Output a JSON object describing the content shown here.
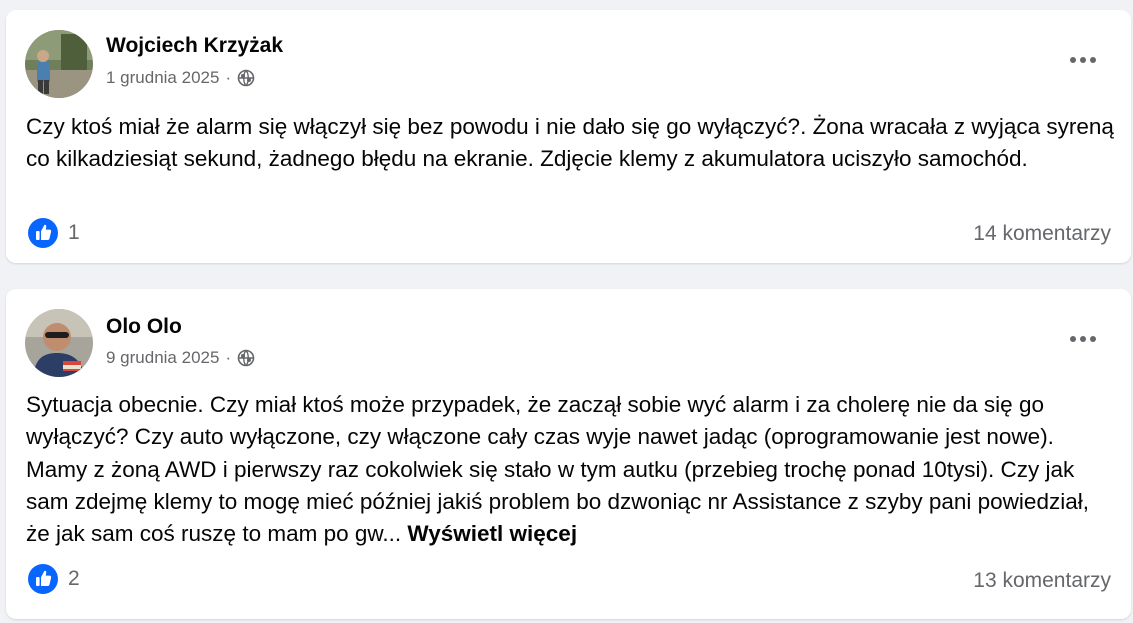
{
  "posts": [
    {
      "author": "Wojciech Krzyżak",
      "date": "1 grudnia 2025",
      "separator": "·",
      "privacy_icon": "globe-icon",
      "body": "Czy ktoś miał że alarm się włączył się bez powodu i nie dało się go wyłączyć?. Żona wracała z wyjąca syreną co kilkadziesiąt sekund, żadnego błędu na ekranie. Zdjęcie klemy z akumulatora uciszyło samochód.",
      "see_more": "",
      "reaction_icon": "like-icon",
      "reaction_count": "1",
      "comments": "14 komentarzy"
    },
    {
      "author": "Olo Olo",
      "date": "9 grudnia 2025",
      "separator": "·",
      "privacy_icon": "globe-icon",
      "body": "Sytuacja obecnie. Czy miał ktoś może przypadek, że zaczął sobie wyć alarm i za cholerę nie da się go wyłączyć? Czy auto wyłączone, czy włączone cały czas wyje nawet jadąc (oprogramowanie jest nowe). Mamy z żoną AWD i pierwszy raz cokolwiek się stało w tym autku (przebieg trochę ponad 10tysi). Czy jak sam zdejmę klemy to mogę mieć później jakiś problem bo dzwoniąc nr Assistance z szyby pani powiedział, że jak sam coś ruszę to mam po gw...",
      "see_more": "Wyświetl więcej",
      "reaction_icon": "like-icon",
      "reaction_count": "2",
      "comments": "13 komentarzy"
    }
  ],
  "colors": {
    "background": "#f0f2f5",
    "card": "#ffffff",
    "text_primary": "#050505",
    "text_secondary": "#65676b",
    "like_blue": "#0866ff"
  }
}
